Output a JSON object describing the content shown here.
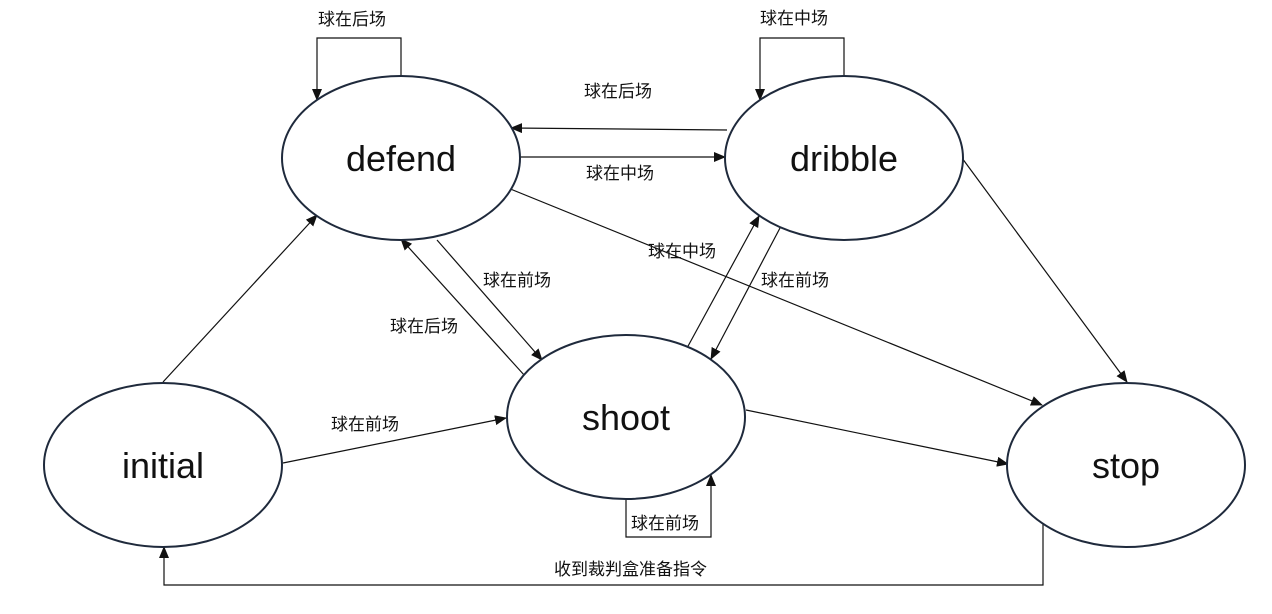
{
  "states": {
    "defend": "defend",
    "dribble": "dribble",
    "initial": "initial",
    "shoot": "shoot",
    "stop": "stop"
  },
  "transitions": {
    "defend_self": "球在后场",
    "dribble_self": "球在中场",
    "dribble_to_defend": "球在后场",
    "defend_to_dribble": "球在中场",
    "defend_to_shoot": "球在前场",
    "shoot_to_defend": "球在后场",
    "shoot_to_dribble": "球在中场",
    "dribble_to_shoot": "球在前场",
    "initial_to_shoot": "球在前场",
    "shoot_self": "球在前场",
    "stop_to_initial": "收到裁判盒准备指令"
  }
}
